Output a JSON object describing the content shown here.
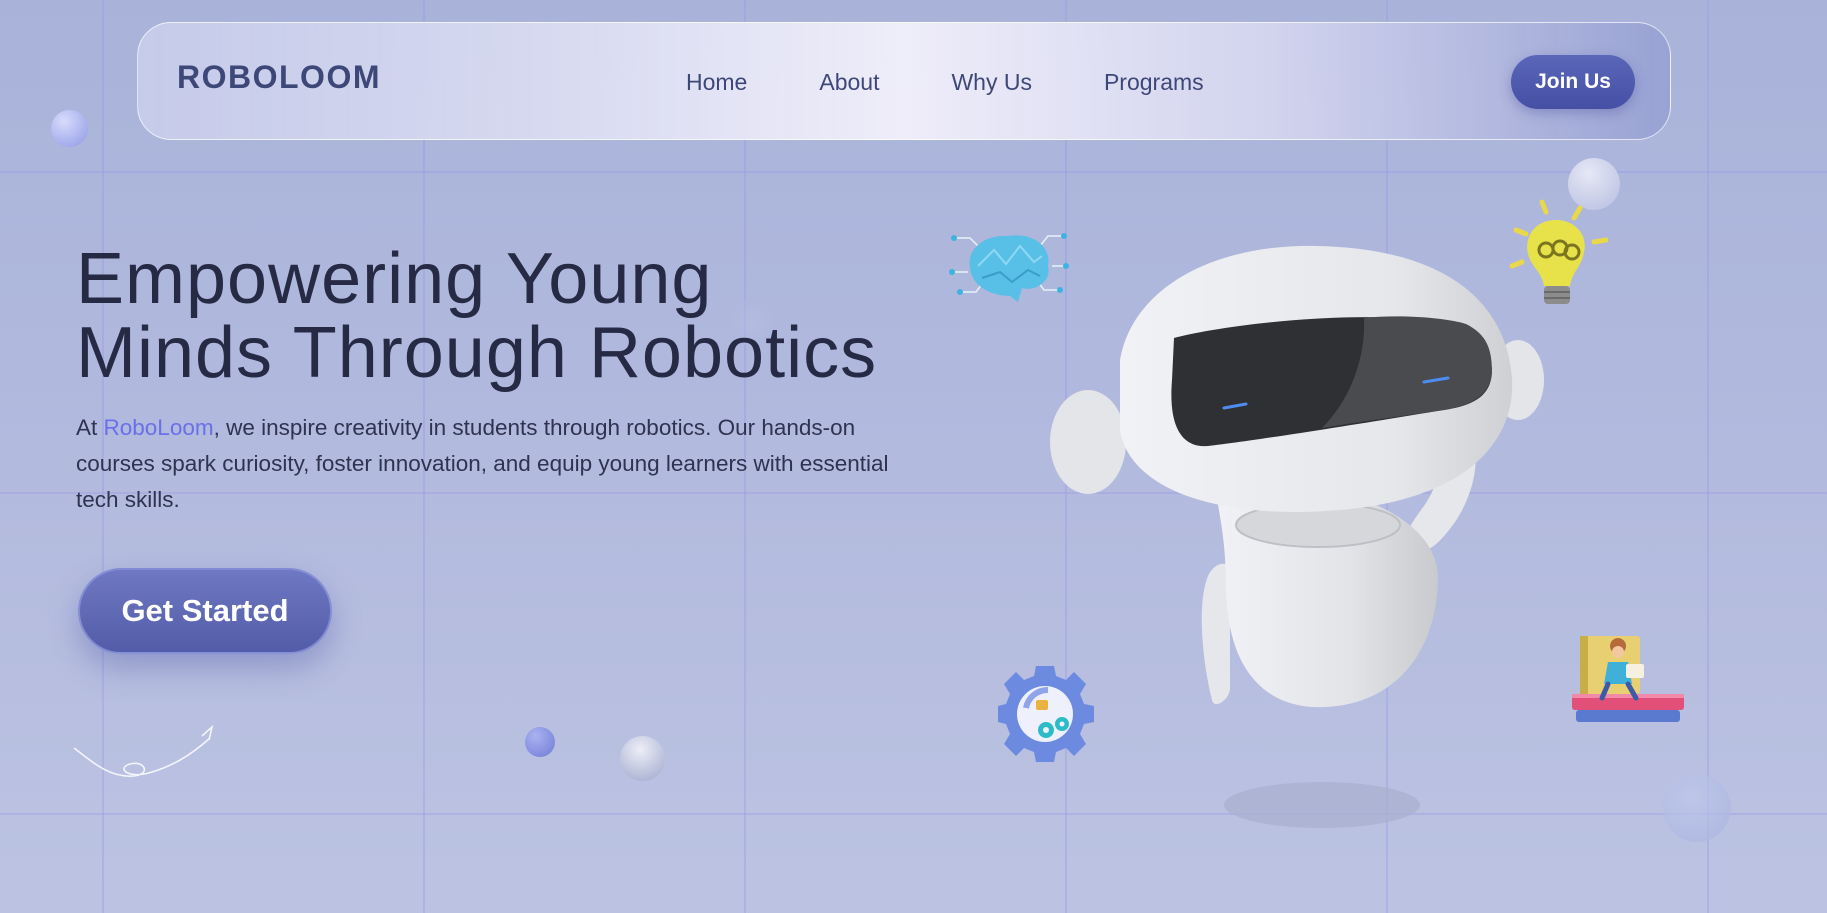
{
  "navbar": {
    "logo": "ROBOLOOM",
    "links": [
      "Home",
      "About",
      "Why Us",
      "Programs"
    ],
    "join_label": "Join Us"
  },
  "hero": {
    "title_line1": "Empowering Young",
    "title_line2": "Minds Through Robotics",
    "desc_prefix": "At ",
    "desc_brand": "RoboLoom",
    "desc_rest": ", we inspire creativity in students through robotics. Our hands-on courses spark curiosity, foster innovation, and equip young learners with essential tech skills.",
    "cta_label": "Get Started"
  },
  "colors": {
    "accent": "#5a66b8",
    "brand_text": "#6a70e8",
    "heading": "#272a45",
    "background": "#b0b8dd"
  },
  "icons": [
    "brain-icon",
    "lightbulb-icon",
    "gear-icon",
    "books-icon",
    "robot-illustration",
    "arrow-doodle-icon"
  ]
}
